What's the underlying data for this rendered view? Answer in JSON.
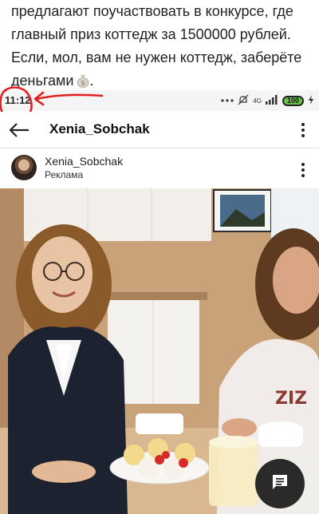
{
  "caption": {
    "lines": [
      "предлагают поучаствовать в конкурсе, где",
      "главный приз коттедж за 1500000 рублей.",
      "Если, мол, вам не нужен коттедж, заберёте",
      "деньгами"
    ],
    "emoji_icon": "money-bag-icon"
  },
  "statusbar": {
    "time": "11:12",
    "network": "4G",
    "battery": "100",
    "icons": [
      "dots-icon",
      "mute-icon",
      "signal-icon",
      "battery-icon",
      "charging-icon"
    ]
  },
  "header": {
    "title": "Xenia_Sobchak",
    "back_icon": "arrow-left-icon",
    "menu_icon": "more-vert-icon"
  },
  "post": {
    "username": "Xenia_Sobchak",
    "label": "Реклама",
    "menu_icon": "more-vert-icon"
  },
  "fab": {
    "icon": "chat-icon"
  },
  "colors": {
    "annotation_red": "#e02020",
    "battery_green": "#6cc04a",
    "fab_bg": "#2a2a2a"
  }
}
